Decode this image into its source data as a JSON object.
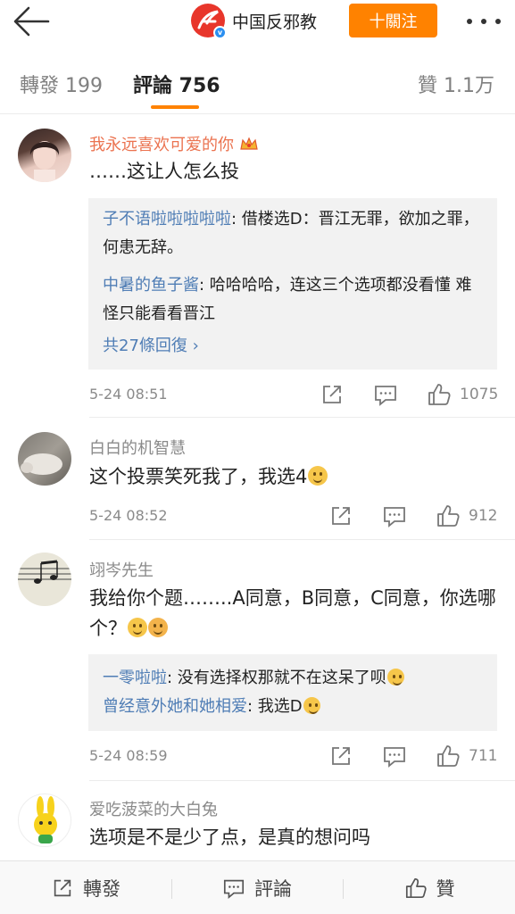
{
  "header": {
    "account_name": "中国反邪教",
    "follow_label": "十關注"
  },
  "tabs": {
    "repost": "轉發 199",
    "comments": "評論 756",
    "likes": "贊 1.1万"
  },
  "comments": [
    {
      "name": "我永远喜欢可爱的你",
      "text": "……这让人怎么投",
      "replies": [
        {
          "name": "子不语啦啦啦啦啦",
          "text": ": 借楼选D：晋江无罪，欲加之罪，何患无辞。"
        },
        {
          "name": "中暑的鱼子酱",
          "text": ": 哈哈哈哈，连这三个选项都没看懂 难怪只能看看晋江"
        }
      ],
      "more_replies": "共27條回復 ›",
      "time": "5-24 08:51",
      "likes": "1075"
    },
    {
      "name": "白白的机智慧",
      "text": "这个投票笑死我了，我选4",
      "time": "5-24 08:52",
      "likes": "912"
    },
    {
      "name": "翊岑先生",
      "text": "我给你个题……..A同意，B同意，C同意，你选哪个？",
      "replies": [
        {
          "name": "一零啦啦",
          "text": ": 没有选择权那就不在这呆了呗"
        },
        {
          "name": "曾经意外她和她相爱",
          "text": ": 我选D"
        }
      ],
      "time": "5-24 08:59",
      "likes": "711"
    },
    {
      "name": "爱吃菠菜的大白兔",
      "text": "选项是不是少了点，是真的想问吗"
    }
  ],
  "bottom_bar": {
    "repost": "轉發",
    "comment": "評論",
    "like": "贊"
  },
  "colors": {
    "accent": "#ff8200",
    "link": "#4f7db5",
    "vip_name": "#eb7350"
  }
}
